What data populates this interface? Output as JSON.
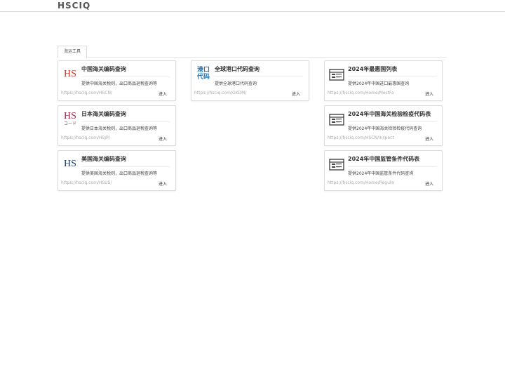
{
  "header": {
    "logo": "HSCIQ"
  },
  "tabs": [
    {
      "label": "海运工具"
    }
  ],
  "cards": [
    {
      "title": "中国海关编码查询",
      "desc": "提供中国海关税则，出口商品退税查询等",
      "url": "https://hsciq.com/HSCN/",
      "enter": "进入",
      "icon_text": "HS",
      "icon_color": "#c0392b"
    },
    {
      "title": "全球港口代码查询",
      "desc": "提供全球港口代码查询",
      "url": "https://hsciq.com/GKDM/",
      "enter": "进入",
      "icon_text_1": "港口",
      "icon_text_2": "代码",
      "icon_color": "#1c78c0"
    },
    {
      "title": "2024年最惠国列表",
      "desc": "提供2024年中国进口最惠国查询",
      "url": "https://hsciq.com/Home/MostFavo...",
      "enter": "进入"
    },
    {
      "title": "日本海关编码查询",
      "desc": "提供日本海关税则，出口商品退税查询等",
      "url": "https://hsciq.com/HSJP/",
      "enter": "进入",
      "icon_text": "HS",
      "icon_sub": "コード",
      "icon_color": "#a8234a"
    },
    {
      "title": "2024年中国海关检验检疫代码表",
      "desc": "提供2024年中国海关检验检疫代码查询",
      "url": "https://hsciq.com/HSCN/Inspect",
      "enter": "进入"
    },
    {
      "title": "美国海关编码查询",
      "desc": "提供美国海关税则，出口商品退税查询等",
      "url": "https://hsciq.com/HSUS/",
      "enter": "进入",
      "icon_text": "HS",
      "icon_color": "#1d3a6b"
    },
    {
      "title": "2024年中国监管条件代码表",
      "desc": "提供2024年中国监管条件代码查询",
      "url": "https://hsciq.com/Home/Regulatory",
      "enter": "进入"
    }
  ]
}
